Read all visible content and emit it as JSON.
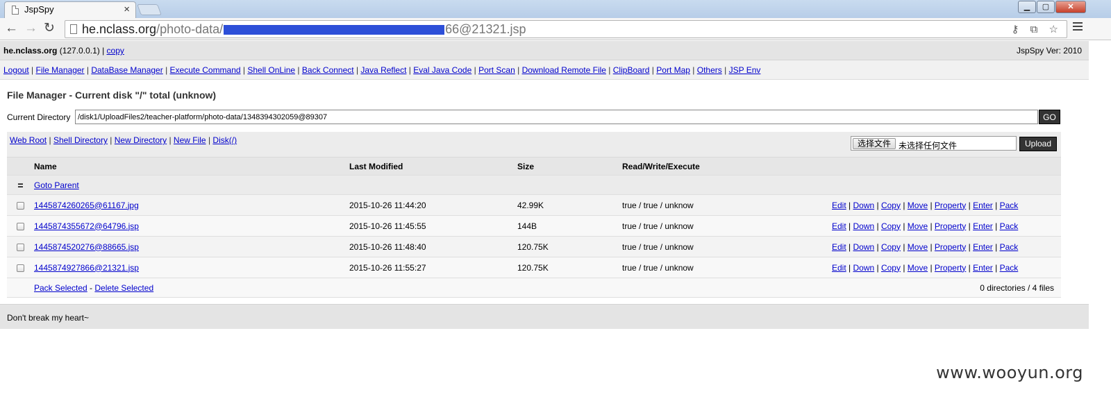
{
  "browser": {
    "tab_title": "JspSpy",
    "tab_close": "×",
    "url_host": "he.nclass.org",
    "url_path_prefix": "/photo-data/",
    "url_tail": "66@21321.jsp",
    "window_controls": {
      "min": "▁",
      "max": "▢",
      "close": "✕"
    },
    "nav_icons": {
      "back": "←",
      "forward": "→",
      "reload": "↻"
    },
    "omnibox_icons": "⚷ ⧉ ☆"
  },
  "header": {
    "host": "he.nclass.org",
    "ip": " (127.0.0.1) | ",
    "copy_label": "copy",
    "version": "JspSpy Ver: 2010"
  },
  "menu": [
    "Logout",
    "File Manager",
    "DataBase Manager",
    "Execute Command",
    "Shell OnLine",
    "Back Connect",
    "Java Reflect",
    "Eval Java Code",
    "Port Scan",
    "Download Remote File",
    "ClipBoard",
    "Port Map",
    "Others",
    "JSP Env"
  ],
  "file_manager": {
    "title": "File Manager - Current disk \"/\" total (unknow)",
    "current_dir_label": "Current Directory",
    "current_dir_value": "/disk1/UploadFiles2/teacher-platform/photo-data/1348394302059@89307",
    "go_label": "GO",
    "quick_links": [
      "Web Root",
      "Shell Directory",
      "New Directory",
      "New File",
      "Disk(/)"
    ],
    "choose_file_label": "选择文件",
    "no_file_label": "未选择任何文件",
    "upload_label": "Upload",
    "columns": {
      "name": "Name",
      "modified": "Last Modified",
      "size": "Size",
      "rwx": "Read/Write/Execute"
    },
    "parent_marker": "=",
    "parent_label": "Goto Parent",
    "files": [
      {
        "name": "1445874260265@61167.jpg",
        "modified": "2015-10-26 11:44:20",
        "size": "42.99K",
        "rwx": "true / true / unknow"
      },
      {
        "name": "1445874355672@64796.jsp",
        "modified": "2015-10-26 11:45:55",
        "size": "144B",
        "rwx": "true / true / unknow"
      },
      {
        "name": "1445874520276@88665.jsp",
        "modified": "2015-10-26 11:48:40",
        "size": "120.75K",
        "rwx": "true / true / unknow"
      },
      {
        "name": "1445874927866@21321.jsp",
        "modified": "2015-10-26 11:55:27",
        "size": "120.75K",
        "rwx": "true / true / unknow"
      }
    ],
    "actions": [
      "Edit",
      "Down",
      "Copy",
      "Move",
      "Property",
      "Enter",
      "Pack"
    ],
    "pack_selected": "Pack Selected",
    "delete_selected": "Delete Selected",
    "footer_dash": " - ",
    "count_text": "0 directories / 4 files"
  },
  "footer_text": "Don't break my heart~",
  "watermark": "www.wooyun.org"
}
